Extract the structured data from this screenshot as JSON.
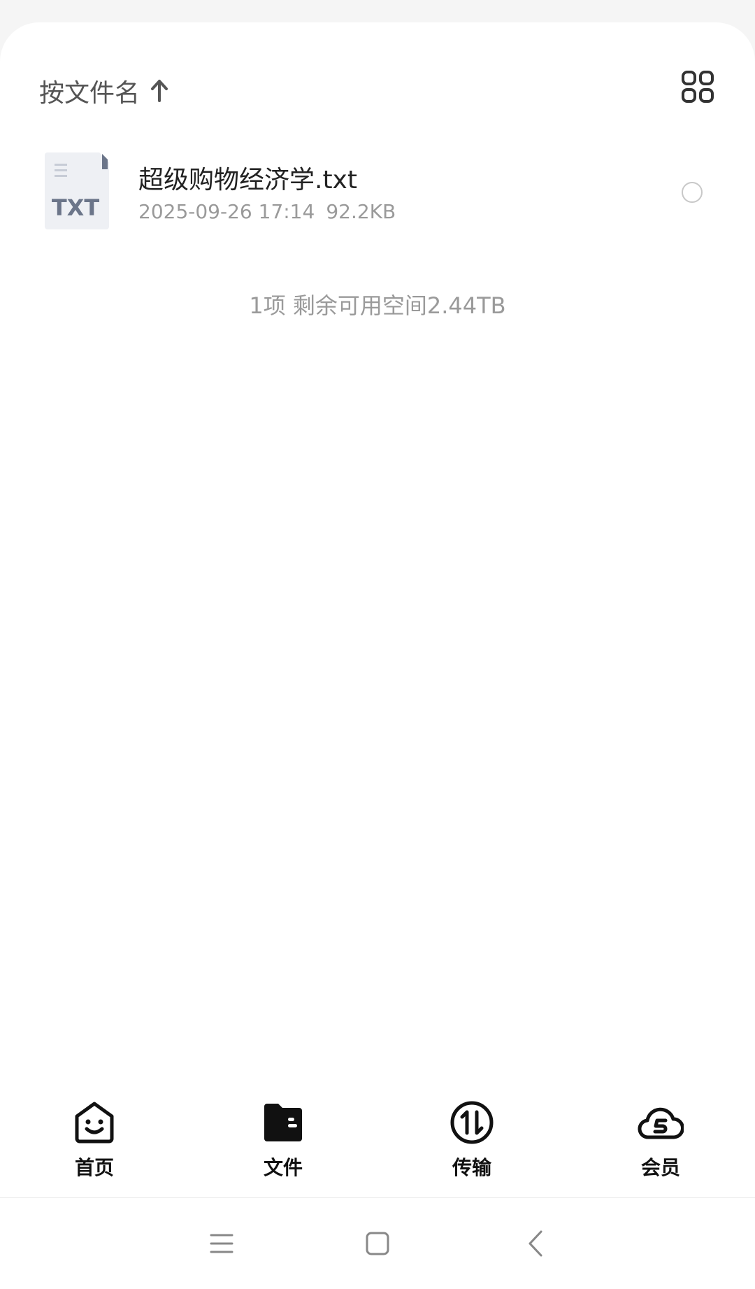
{
  "header": {
    "sort_label": "按文件名",
    "sort_arrow_icon": "arrow-up-icon",
    "view_toggle_icon": "grid-view-icon"
  },
  "files": [
    {
      "name": "超级购物经济学.txt",
      "date": "2025-09-26 17:14",
      "size": "92.2KB",
      "type_badge": "TXT",
      "icon": "txt-file-icon"
    }
  ],
  "summary": {
    "text": "1项 剩余可用空间2.44TB"
  },
  "tabbar": {
    "items": [
      {
        "label": "首页",
        "icon": "home-smile-icon",
        "active": false
      },
      {
        "label": "文件",
        "icon": "folder-icon",
        "active": true
      },
      {
        "label": "传输",
        "icon": "transfer-icon",
        "active": false
      },
      {
        "label": "会员",
        "icon": "cloud-vip-icon",
        "active": false
      }
    ]
  },
  "system_nav": {
    "icons": [
      "menu-icon",
      "home-square-icon",
      "back-icon"
    ]
  },
  "colors": {
    "text_primary": "#222222",
    "text_secondary": "#9a9a9a",
    "icon_dark": "#111111",
    "txt_badge": "#6b7589"
  }
}
